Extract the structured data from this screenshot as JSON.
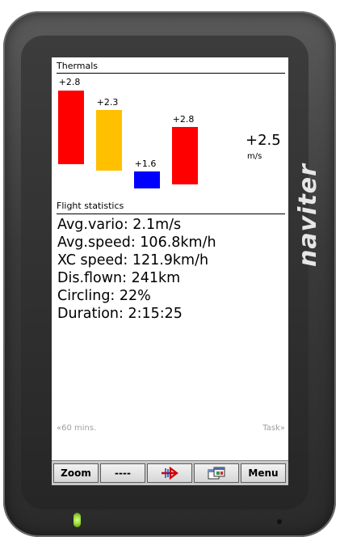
{
  "brand": "naviter",
  "thermals": {
    "title": "Thermals",
    "bars": [
      {
        "label": "+2.8",
        "color": "#ff0000"
      },
      {
        "label": "+2.3",
        "color": "#ffc000"
      },
      {
        "label": "+1.6",
        "color": "#0000ff"
      },
      {
        "label": "+2.8",
        "color": "#ff0000"
      }
    ],
    "average": {
      "value": "+2.5",
      "unit": "m/s"
    }
  },
  "flight_statistics": {
    "title": "Flight statistics",
    "rows": [
      "Avg.vario: 2.1m/s",
      "Avg.speed: 106.8km/h",
      "XC speed: 121.9km/h",
      "Dis.flown: 241km",
      "Circling: 22%",
      "Duration:  2:15:25"
    ]
  },
  "footer": {
    "left": "«60 mins.",
    "right": "Task»"
  },
  "toolbar": {
    "zoom": "Zoom",
    "dashes": "----",
    "menu": "Menu"
  }
}
